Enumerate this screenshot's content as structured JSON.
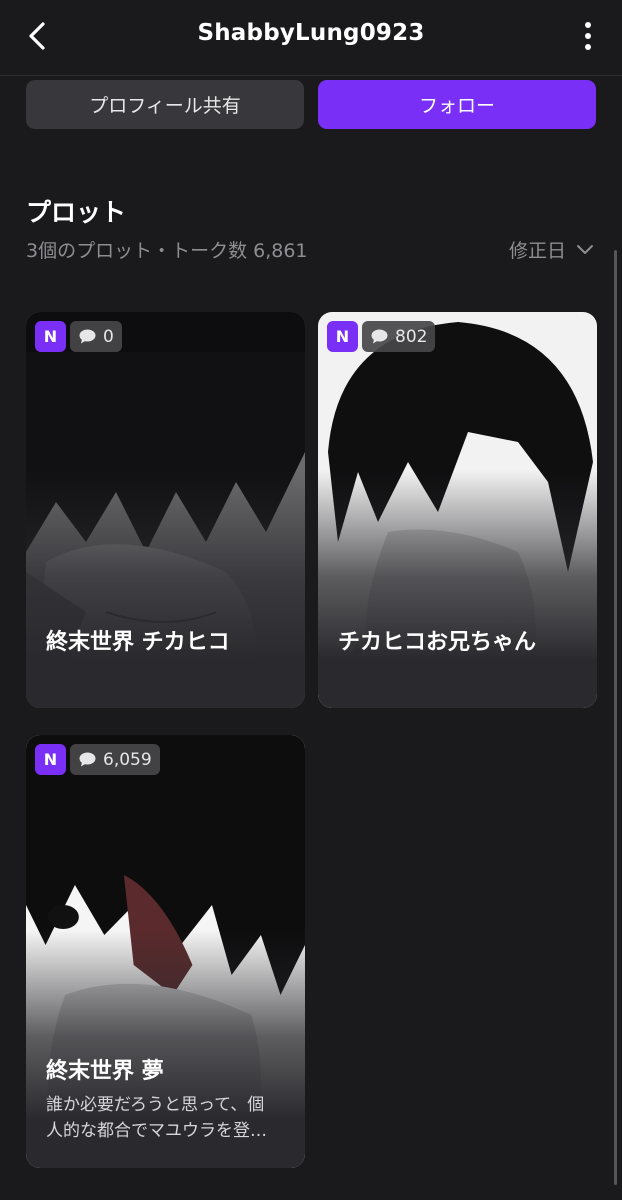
{
  "header": {
    "title": "ShabbyLung0923",
    "back_icon": "chevron-left-icon",
    "more_icon": "more-vertical-icon"
  },
  "actions": {
    "share_label": "プロフィール共有",
    "follow_label": "フォロー"
  },
  "section": {
    "title": "プロット",
    "meta": "3個のプロット・トーク数 6,861",
    "sort_label": "修正日"
  },
  "cards": [
    {
      "badge": "N",
      "count": "0",
      "title": "終末世界 チカヒコ",
      "description": ""
    },
    {
      "badge": "N",
      "count": "802",
      "title": "チカヒコお兄ちゃん",
      "description": ""
    },
    {
      "badge": "N",
      "count": "6,059",
      "title": "終末世界 夢",
      "description": "誰か必要だろうと思って、個人的な都合でマユウラを登録しました。"
    }
  ],
  "colors": {
    "background": "#1a1a1d",
    "accent": "#7a2ff7",
    "card": "#2a2a2e",
    "secondary_button": "#38383c",
    "muted_text": "#8d8d92"
  }
}
